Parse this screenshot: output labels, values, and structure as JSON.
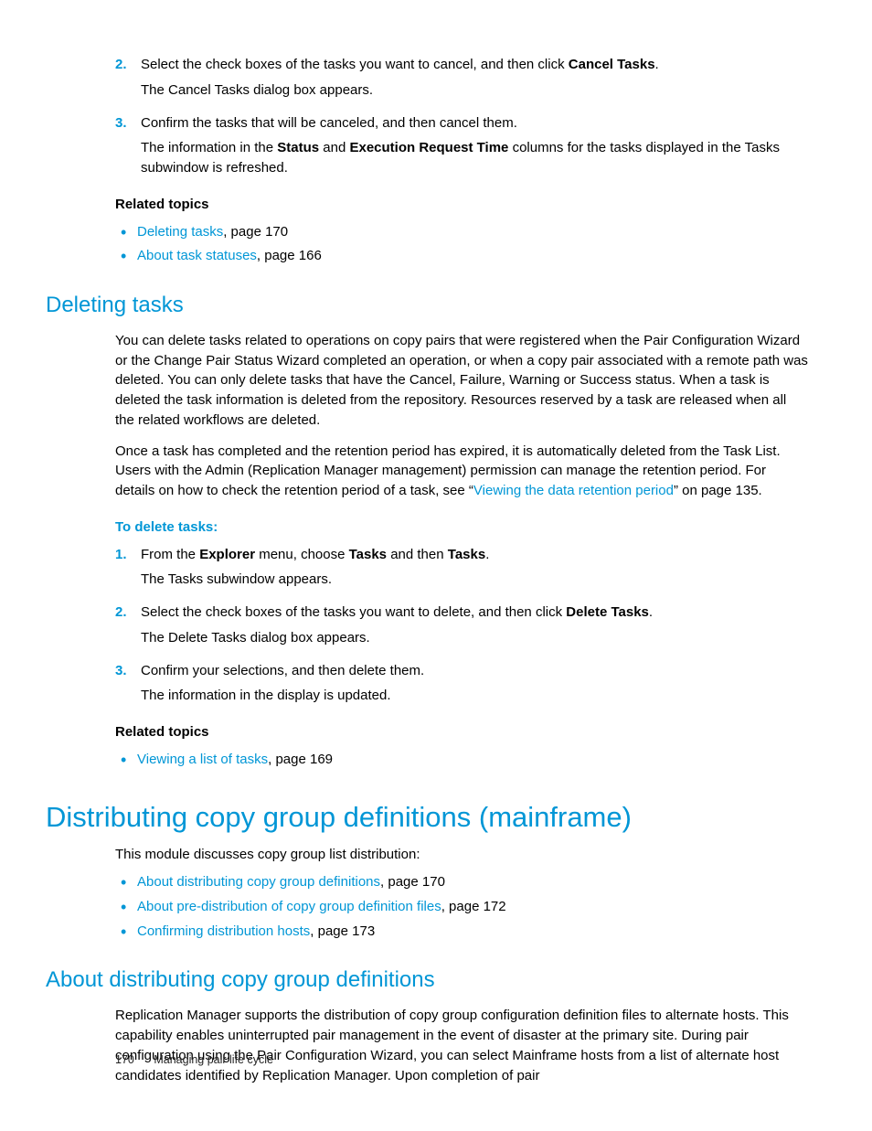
{
  "step2": {
    "num": "2.",
    "text_a": "Select the check boxes of the tasks you want to cancel, and then click ",
    "text_b": "Cancel Tasks",
    "text_c": ".",
    "sub": "The Cancel Tasks dialog box appears."
  },
  "step3": {
    "num": "3.",
    "text": "Confirm the tasks that will be canceled, and then cancel them.",
    "sub_a": "The information in the ",
    "sub_b": "Status",
    "sub_c": " and ",
    "sub_d": "Execution Request Time",
    "sub_e": " columns for the tasks displayed in the Tasks subwindow is refreshed."
  },
  "related1": {
    "head": "Related topics",
    "items": [
      {
        "link": "Deleting tasks",
        "rest": ", page 170"
      },
      {
        "link": "About task statuses",
        "rest": ", page 166"
      }
    ]
  },
  "h_del": "Deleting tasks",
  "del_p1": "You can delete tasks related to operations on copy pairs that were registered when the Pair Configuration Wizard or the Change Pair Status Wizard completed an operation, or when a copy pair associated with a remote path was deleted. You can only delete tasks that have the Cancel, Failure, Warning or Success status. When a task is deleted the task information is deleted from the repository. Resources reserved by a task are released when all the related workflows are deleted.",
  "del_p2_a": "Once a task has completed and the retention period has expired, it is automatically deleted from the Task List. Users with the Admin (Replication Manager management) permission can manage the retention period. For details on how to check the retention period of a task, see “",
  "del_p2_link": "Viewing the data retention period",
  "del_p2_b": "” on page 135.",
  "del_proc_head": "To delete tasks:",
  "dstep1": {
    "num": "1.",
    "a": "From the ",
    "b": "Explorer",
    "c": " menu, choose ",
    "d": "Tasks",
    "e": " and then ",
    "f": "Tasks",
    "g": ".",
    "sub": "The Tasks subwindow appears."
  },
  "dstep2": {
    "num": "2.",
    "a": "Select the check boxes of the tasks you want to delete, and then click ",
    "b": "Delete Tasks",
    "c": ".",
    "sub": "The Delete Tasks dialog box appears."
  },
  "dstep3": {
    "num": "3.",
    "text": "Confirm your selections, and then delete them.",
    "sub": "The information in the display is updated."
  },
  "related2": {
    "head": "Related topics",
    "items": [
      {
        "link": "Viewing a list of tasks",
        "rest": ", page 169"
      }
    ]
  },
  "h_dist": "Distributing copy group definitions (mainframe)",
  "dist_intro": "This module discusses copy group list distribution:",
  "dist_items": [
    {
      "link": "About distributing copy group definitions",
      "rest": ", page 170"
    },
    {
      "link": "About pre-distribution of copy group definition files",
      "rest": ", page 172"
    },
    {
      "link": "Confirming distribution hosts",
      "rest": ", page 173"
    }
  ],
  "h_about": "About distributing copy group definitions",
  "about_p": "Replication Manager supports the distribution of copy group configuration definition files to alternate hosts. This capability enables uninterrupted pair management in the event of disaster at the primary site. During pair configuration using the Pair Configuration Wizard, you can select Mainframe hosts from a list of alternate host candidates identified by Replication Manager. Upon completion of pair",
  "footer": {
    "page": "170",
    "title": "Managing pair life cycle"
  }
}
